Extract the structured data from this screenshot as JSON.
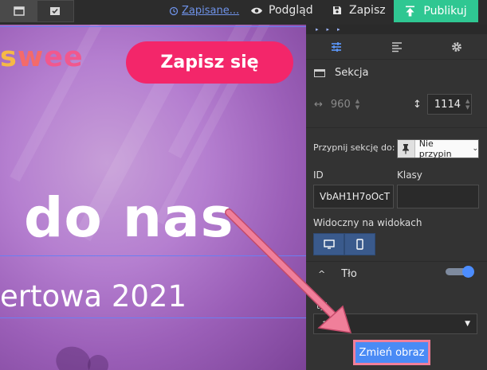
{
  "toolbar": {
    "saved_label": "Zapisane...",
    "preview_label": "Podgląd",
    "save_label": "Zapisz",
    "publish_label": "Publikuj"
  },
  "canvas": {
    "logo": {
      "part1": "s",
      "part2": "w",
      "part3": "ee"
    },
    "cta_label": "Zapisz się",
    "headline": "do nas",
    "subheadline": "ertowa 2021"
  },
  "panel": {
    "tabs": [
      "settings-sliders-icon",
      "align-left-icon",
      "gear-icon"
    ],
    "section_title": "Sekcja",
    "width_value": "960",
    "height_value": "1114",
    "pin_label": "Przypnij sekcję do:",
    "pin_value": "Nie przypin",
    "id_label": "ID",
    "id_value": "VbAH1H7oOcT",
    "classes_label": "Klasy",
    "visible_label": "Widoczny na widokach",
    "background_label": "Tło",
    "style_label": "tyl",
    "style_value": "az",
    "change_image_label": "Zmień obraz"
  },
  "colors": {
    "accent": "#2fc792",
    "cta": "#f3266a",
    "link": "#6f93ea",
    "button": "#4a8bf5",
    "annotation": "#f07f9a"
  }
}
